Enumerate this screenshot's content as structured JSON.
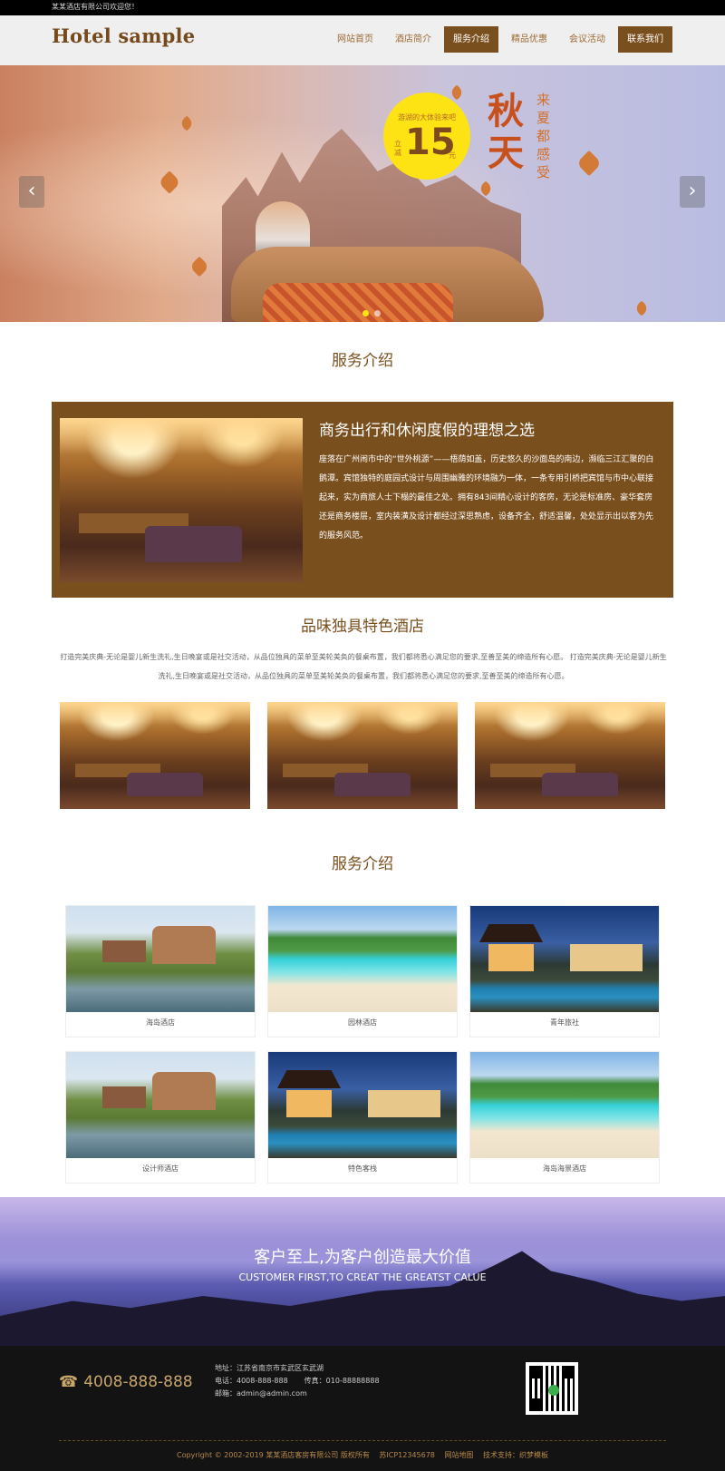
{
  "topbar": {
    "welcome": "某某酒店有限公司欢迎您！"
  },
  "header": {
    "logo": "Hotel sample",
    "nav": [
      {
        "label": "网站首页",
        "active": false
      },
      {
        "label": "酒店简介",
        "active": false
      },
      {
        "label": "服务介绍",
        "active": true
      },
      {
        "label": "精品优惠",
        "active": false
      },
      {
        "label": "会议活动",
        "active": false
      },
      {
        "label": "联系我们",
        "active": true
      }
    ]
  },
  "banner": {
    "promo_text": "游湖的大体验来吧",
    "promo_number": "15",
    "promo_prefix": "立减",
    "promo_unit": "元",
    "headline": "秋天",
    "subline": "来夏都感受",
    "prev_icon": "chevron-left-icon",
    "next_icon": "chevron-right-icon",
    "slide_index": 1,
    "slide_count": 2
  },
  "section1": {
    "title": "服务介绍",
    "feature_title": "商务出行和休闲度假的理想之选",
    "feature_text": "座落在广州闹市中的“世外桃源”——梧荫如盖，历史悠久的沙面岛的南边，濒临三江汇聚的白鹅潭。宾馆独特的庭园式设计与周围幽雅的环境融为一体，一条专用引桥把宾馆与市中心联接起来，实为商旅人士下榻的最佳之处。拥有843间精心设计的客房，无论是标准房、豪华套房还是商务楼层，室内装潢及设计都经过深思熟虑，设备齐全，舒适温馨，处处显示出以客为先的服务风范。"
  },
  "section2": {
    "title": "品味独具特色酒店",
    "text": "打造完美庆典-无论是婴儿新生洗礼,生日晚宴或是社交活动，从品位独具的菜单至美轮美奂的餐桌布置，我们都将悉心满足您的要求,至善至美的缔造所有心愿。 打造完美庆典-无论是婴儿新生洗礼,生日晚宴或是社交活动，从品位独具的菜单至美轮美奂的餐桌布置，我们都将悉心满足您的要求,至善至美的缔造所有心愿。"
  },
  "section3": {
    "title": "服务介绍",
    "cards": [
      {
        "caption": "海岛酒店"
      },
      {
        "caption": "园林酒店"
      },
      {
        "caption": "青年旅社"
      },
      {
        "caption": "设计师酒店"
      },
      {
        "caption": "特色客栈"
      },
      {
        "caption": "海岛海景酒店"
      }
    ]
  },
  "slogan": {
    "cn": "客户至上,为客户创造最大价值",
    "en": "CUSTOMER FIRST,TO CREAT THE GREATST CALUE"
  },
  "footer": {
    "phone_icon": "telephone-icon",
    "phone": "4008-888-888",
    "address": "地址：江苏省南京市玄武区玄武湖",
    "tel": "电话：4008-888-888",
    "fax": "传真：010-88888888",
    "email": "邮箱：admin@admin.com",
    "copyright": "Copyright © 2002-2019 某某酒店客房有限公司 版权所有",
    "icp": "苏ICP12345678",
    "sitemap": "网站地图",
    "support": "技术支持：织梦模板"
  },
  "colors": {
    "brand": "#7a4f1e",
    "accent": "#c8a56a"
  }
}
